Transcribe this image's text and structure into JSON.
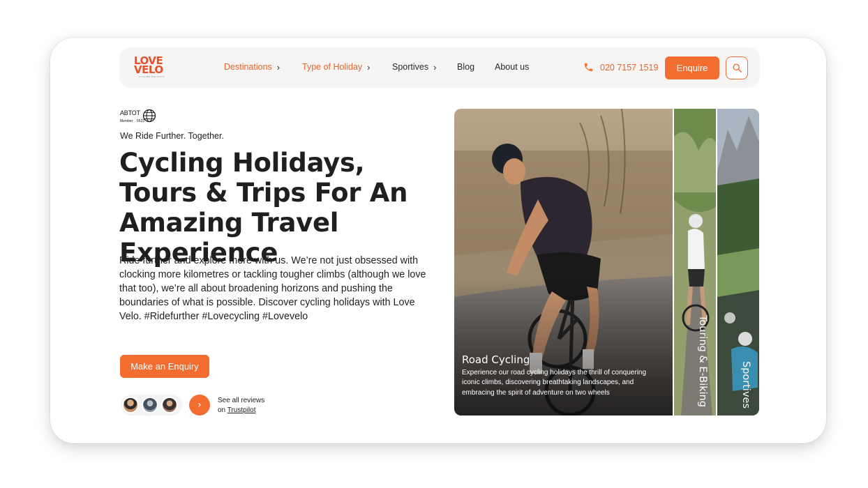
{
  "brand": {
    "logo_line1": "LOVE",
    "logo_line2": "VELO",
    "logo_subtext": "CYCLING HOLIDAYS",
    "accent_color": "#f26d30"
  },
  "nav": {
    "items": [
      {
        "label": "Destinations",
        "has_chevron": true
      },
      {
        "label": "Type of Holiday",
        "has_chevron": true
      },
      {
        "label": "Sportives",
        "has_chevron": true
      },
      {
        "label": "Blog",
        "has_chevron": false
      },
      {
        "label": "About us",
        "has_chevron": false
      }
    ],
    "phone": "020 7157 1519",
    "phone_icon": "phone-icon",
    "enquire_label": "Enquire",
    "search_icon": "search-icon"
  },
  "hero": {
    "badge_name": "ABTOT",
    "badge_member": "Member",
    "badge_number": "5523",
    "tagline": "We Ride Further. Together.",
    "headline": "Cycling Holidays, Tours & Trips For An Amazing Travel Experience",
    "description": "Ride further and explore more with us. We’re not just obsessed with clocking more kilometres or tackling tougher climbs (although we love that too), we’re all about broadening horizons and pushing the boundaries of what is possible. Discover cycling holidays with Love Velo. #Ridefurther #Lovecycling #Lovevelo",
    "cta_label": "Make an Enquiry",
    "reviews_line1": "See all reviews",
    "reviews_line2_prefix": "on",
    "reviews_link": "Trustpilot"
  },
  "panels": {
    "main_title": "Road Cycling",
    "main_text": "Experience our road cycling holidays the thrill of conquering iconic climbs, discovering breathtaking landscapes, and embracing the spirit of adventure on two wheels",
    "second_label": "Touring & E-Biking",
    "third_label": "Sportives"
  }
}
